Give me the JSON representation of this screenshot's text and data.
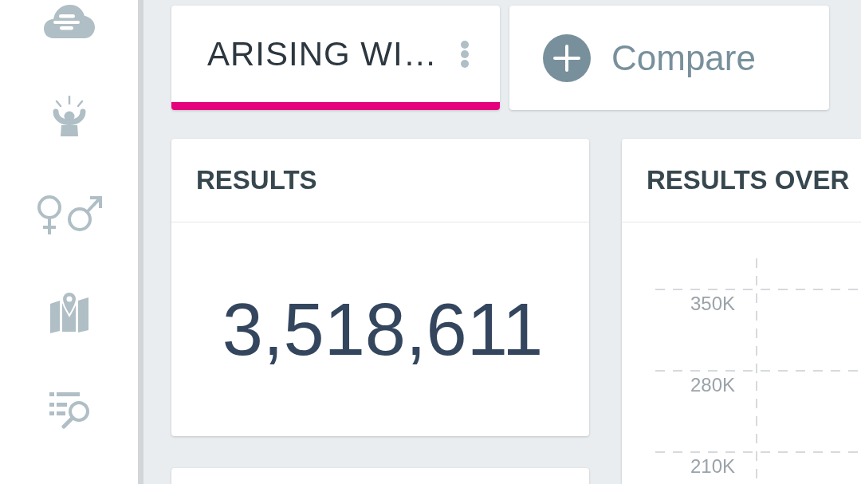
{
  "tabs": [
    {
      "label": "ARISING WI…",
      "selected": true
    }
  ],
  "compare_button": {
    "label": "Compare"
  },
  "results_card": {
    "title": "RESULTS",
    "value": "3,518,611"
  },
  "results_over_card": {
    "title": "RESULTS OVER",
    "y_axis_labels": [
      "350K",
      "280K",
      "210K"
    ]
  }
}
